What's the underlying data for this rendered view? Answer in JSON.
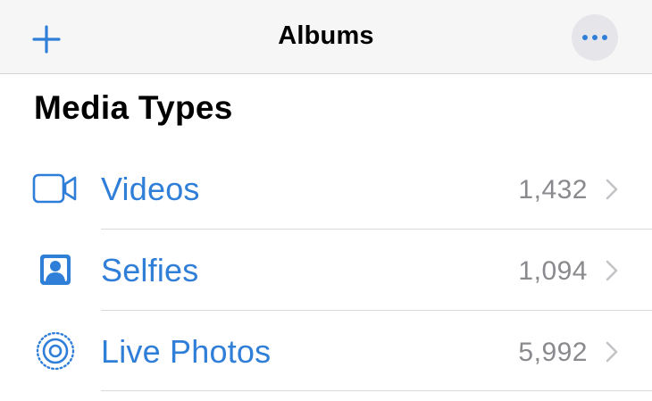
{
  "navbar": {
    "title": "Albums",
    "add_icon": "plus-icon",
    "more_icon": "ellipsis-icon"
  },
  "section": {
    "title": "Media Types"
  },
  "rows": [
    {
      "label": "Videos",
      "count": "1,432",
      "icon": "video-camera-icon"
    },
    {
      "label": "Selfies",
      "count": "1,094",
      "icon": "selfie-portrait-icon"
    },
    {
      "label": "Live Photos",
      "count": "5,992",
      "icon": "live-photo-icon"
    }
  ],
  "colors": {
    "accent": "#2f7ed8",
    "count": "#8a8a8e",
    "chevron": "#c4c4c7",
    "navbar_bg": "#f6f6f6"
  }
}
